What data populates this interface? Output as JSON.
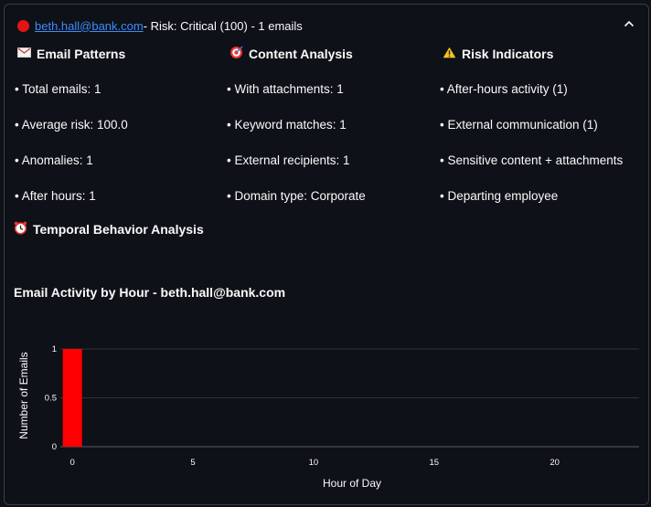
{
  "header": {
    "email": "beth.hall@bank.com",
    "risk_text": " - Risk: Critical (100) - 1 emails",
    "status_color": "#e51414"
  },
  "email_patterns": {
    "title": "Email Patterns",
    "icon": "envelope-icon",
    "items": [
      "Total emails: 1",
      "Average risk: 100.0",
      "Anomalies: 1",
      "After hours: 1"
    ]
  },
  "content_analysis": {
    "title": "Content Analysis",
    "icon": "target-icon",
    "items": [
      "With attachments: 1",
      "Keyword matches: 1",
      "External recipients: 1",
      "Domain type: Corporate"
    ]
  },
  "risk_indicators": {
    "title": "Risk Indicators",
    "icon": "warning-icon",
    "items": [
      "After-hours activity (1)",
      "External communication (1)",
      "Sensitive content + attachments",
      "Departing employee"
    ]
  },
  "temporal": {
    "title": "Temporal Behavior Analysis",
    "icon": "alarm-clock-icon"
  },
  "chart_data": {
    "type": "bar",
    "title": "Email Activity by Hour - beth.hall@bank.com",
    "xlabel": "Hour of Day",
    "ylabel": "Number of Emails",
    "x": [
      0
    ],
    "values": [
      1
    ],
    "xlim": [
      -0.5,
      23.5
    ],
    "ylim": [
      0,
      1
    ],
    "xticks": [
      "0",
      "5",
      "10",
      "15",
      "20"
    ],
    "yticks": [
      "0",
      "0.5",
      "1"
    ],
    "bar_color": "#ff0000",
    "grid": true
  }
}
